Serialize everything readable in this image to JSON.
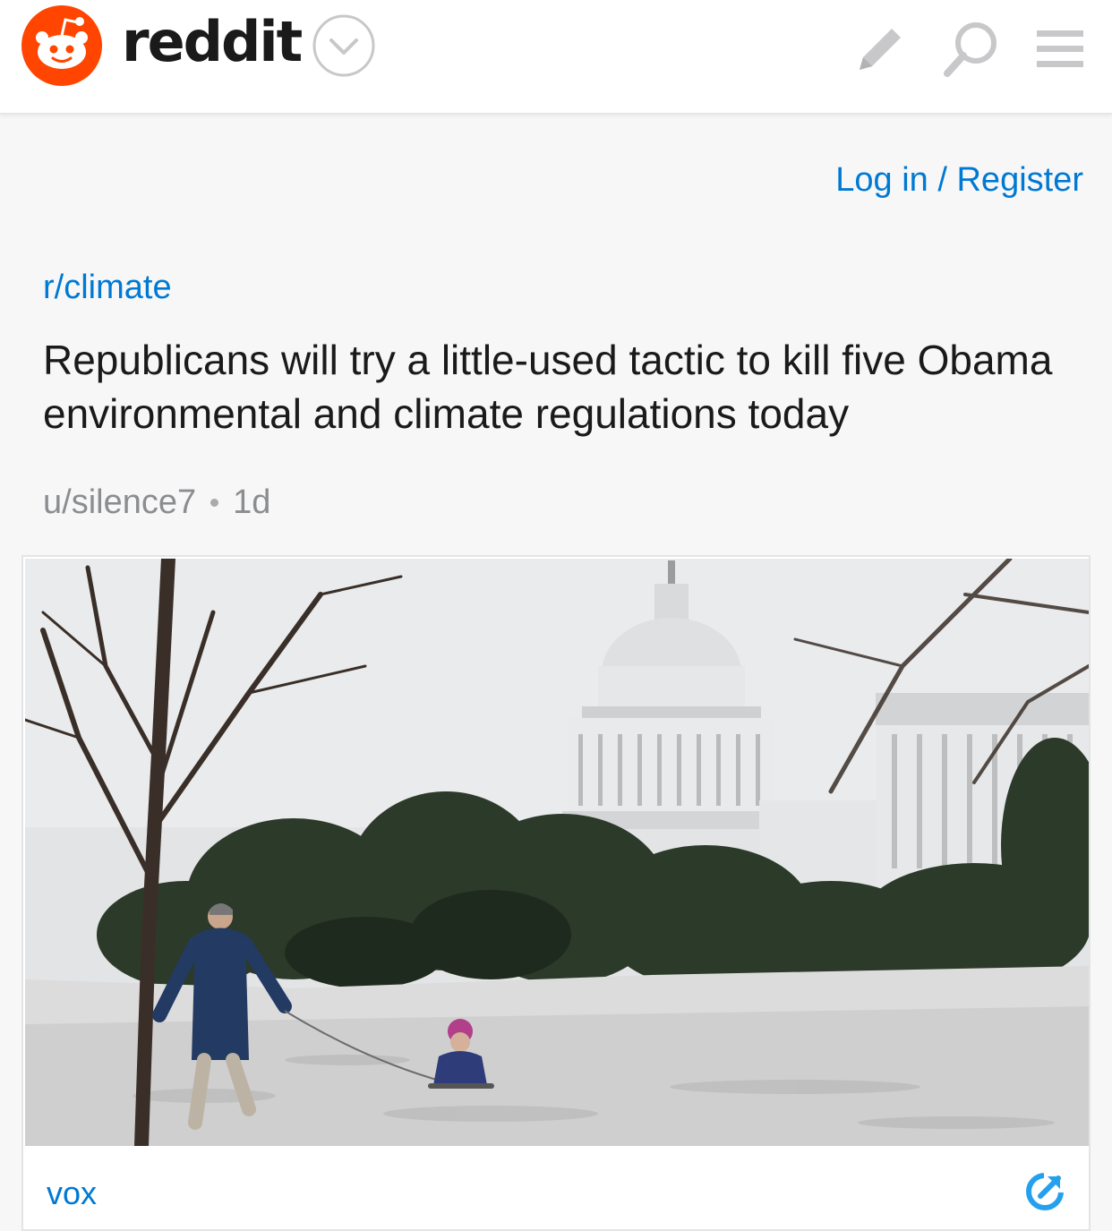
{
  "header": {
    "brand": "reddit",
    "icons": {
      "logo": "snoo-logo-icon",
      "dropdown": "chevron-down-icon",
      "compose": "pencil-icon",
      "search": "search-icon",
      "menu": "hamburger-menu-icon"
    },
    "brand_color": "#ff4500"
  },
  "auth": {
    "login_label": "Log in / Register"
  },
  "post": {
    "subreddit": "r/climate",
    "title": "Republicans will try a little-used tactic to kill five Obama environmental and climate regulations today",
    "author": "u/silence7",
    "age": "1d",
    "link_card": {
      "domain": "vox",
      "image": "photo of US Capitol in snow with a woman pulling a child on a sled",
      "external_icon": "external-link-icon"
    }
  },
  "colors": {
    "link": "#0079d3",
    "text": "#1a1a1b",
    "muted": "#8b8d90",
    "icon_gray": "#c8c8cb"
  }
}
